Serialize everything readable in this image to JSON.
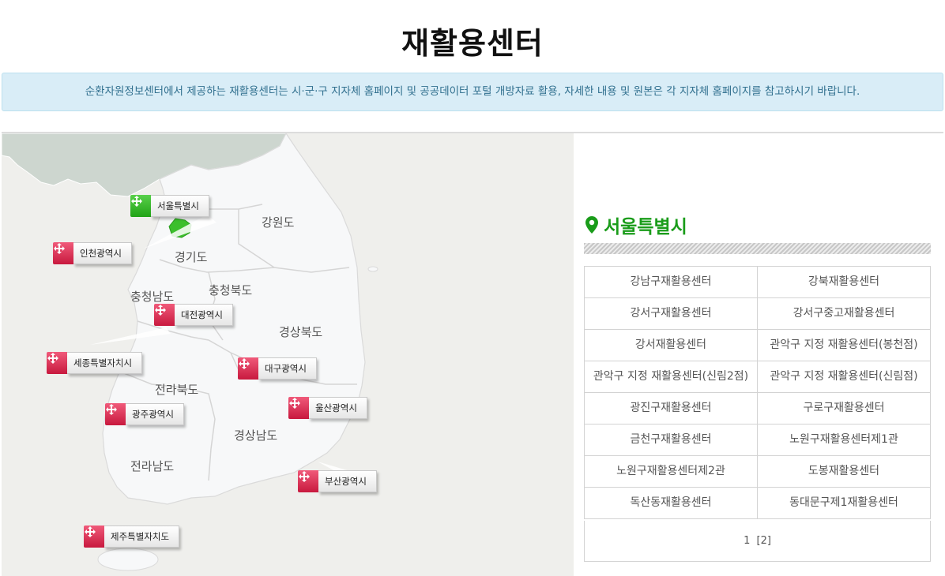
{
  "page": {
    "title": "재활용센터",
    "notice": "순환자원정보센터에서 제공하는 재활용센터는 시·군·구 지자체 홈페이지 및 공공데이터 포털 개방자료 활용, 자세한 내용 및 원본은 각 지자체 홈페이지를 참고하시기 바랍니다."
  },
  "map": {
    "regions": [
      "강원도",
      "경기도",
      "충청북도",
      "충청남도",
      "경상북도",
      "전라북도",
      "경상남도",
      "전라남도"
    ],
    "pins": [
      {
        "label": "서울특별시",
        "color": "green",
        "selected": true
      },
      {
        "label": "인천광역시",
        "color": "red"
      },
      {
        "label": "대전광역시",
        "color": "red"
      },
      {
        "label": "세종특별자치시",
        "color": "red"
      },
      {
        "label": "대구광역시",
        "color": "red"
      },
      {
        "label": "울산광역시",
        "color": "red"
      },
      {
        "label": "광주광역시",
        "color": "red"
      },
      {
        "label": "부산광역시",
        "color": "red"
      },
      {
        "label": "제주특별자치도",
        "color": "red"
      }
    ]
  },
  "panel": {
    "selected_region": "서울특별시",
    "accent_color": "#1a9c1a",
    "centers": [
      [
        "강남구재활용센터",
        "강북재활용센터"
      ],
      [
        "강서구재활용센터",
        "강서구중고재활용센터"
      ],
      [
        "강서재활용센터",
        "관악구 지정 재활용센터(봉천점)"
      ],
      [
        "관악구 지정 재활용센터(신림2점)",
        "관악구 지정 재활용센터(신림점)"
      ],
      [
        "광진구재활용센터",
        "구로구재활용센터"
      ],
      [
        "금천구재활용센터",
        "노원구재활용센터제1관"
      ],
      [
        "노원구재활용센터제2관",
        "도봉재활용센터"
      ],
      [
        "독산동재활용센터",
        "동대문구제1재활용센터"
      ]
    ],
    "pagination": {
      "current": "1",
      "next": "[2]"
    }
  },
  "icons": {
    "pin_icon": "location-pin-icon",
    "badge_icon": "cross-arrows-icon"
  }
}
